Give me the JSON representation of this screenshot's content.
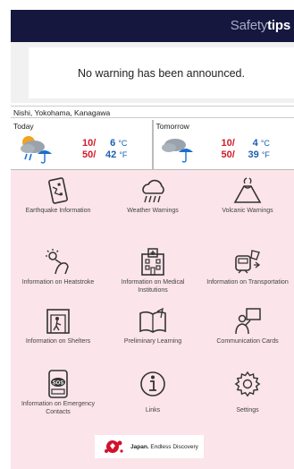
{
  "header": {
    "title_light": "Safety",
    "title_bold": "tips"
  },
  "notice": {
    "text": "No warning has been announced."
  },
  "location": {
    "text": "Nishi, Yokohama, Kanagawa"
  },
  "weather": {
    "today": {
      "label": "Today",
      "precip_chance": "10/",
      "precip_chance2": "50/",
      "temp_c": "6",
      "temp_f": "42",
      "icon": "cloud-rain-umbrella-icon"
    },
    "tomorrow": {
      "label": "Tomorrow",
      "precip_chance": "10/",
      "precip_chance2": "50/",
      "temp_c": "4",
      "temp_f": "39",
      "icon": "cloud-umbrella-icon"
    },
    "unit_c": "°C",
    "unit_f": "°F"
  },
  "menu": {
    "items": [
      {
        "label": "Earthquake Information",
        "icon": "earthquake-icon"
      },
      {
        "label": "Weather Warnings",
        "icon": "rain-cloud-icon"
      },
      {
        "label": "Volcanic Warnings",
        "icon": "volcano-icon"
      },
      {
        "label": "Information on Heatstroke",
        "icon": "heatstroke-icon"
      },
      {
        "label": "Information on Medical Institutions",
        "icon": "hospital-icon"
      },
      {
        "label": "Information on Transportation",
        "icon": "train-icon"
      },
      {
        "label": "Information on Shelters",
        "icon": "shelter-icon"
      },
      {
        "label": "Preliminary Learning",
        "icon": "book-icon"
      },
      {
        "label": "Communication Cards",
        "icon": "communication-card-icon"
      },
      {
        "label": "Information on Emergency Contacts",
        "icon": "sos-phone-icon"
      },
      {
        "label": "Links",
        "icon": "info-icon"
      },
      {
        "label": "Settings",
        "icon": "gear-icon"
      }
    ]
  },
  "brand": {
    "name": "Japan.",
    "tagline": "Endless Discovery"
  },
  "colors": {
    "header": "#15173f",
    "menu_bg": "#fbe4ea",
    "temp_red": "#d01b2a",
    "temp_blue": "#1a5fb4"
  }
}
